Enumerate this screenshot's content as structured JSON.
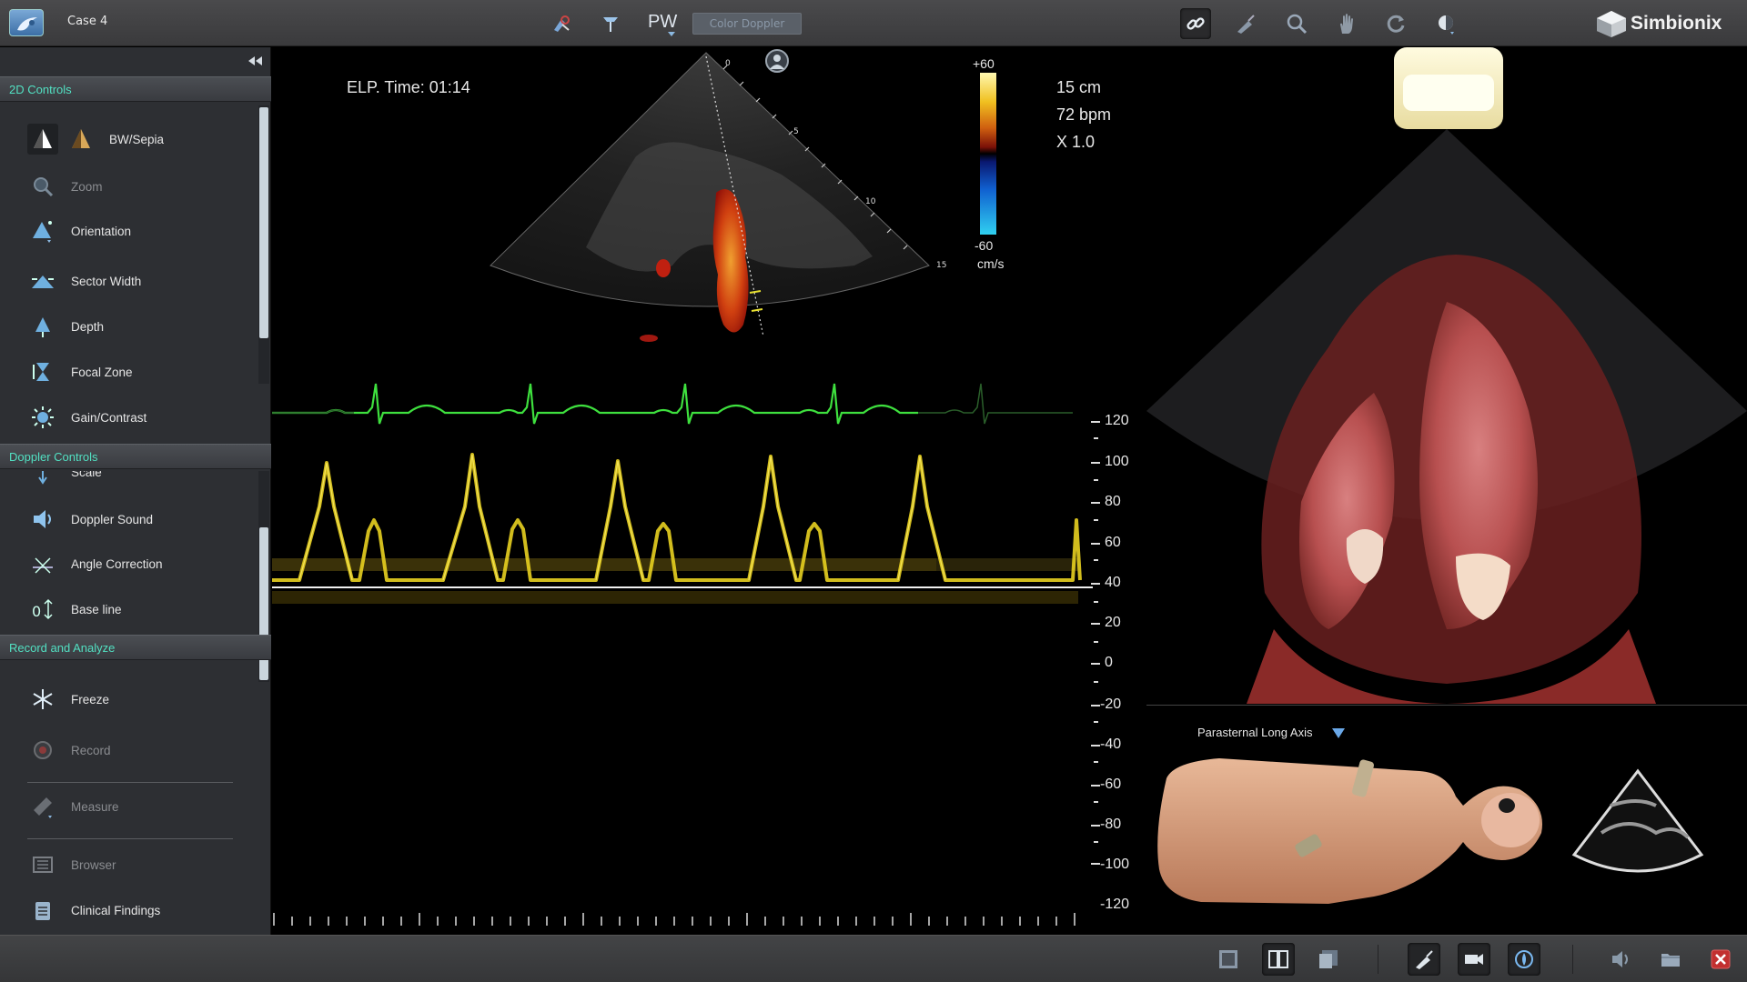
{
  "topbar": {
    "case_title": "Case 4",
    "mode_label": "PW",
    "color_doppler_label": "Color Doppler",
    "brand_name": "Simbionix",
    "tools_left": [
      "probe-settings-icon",
      "cursor-probe-icon"
    ],
    "tools_right": [
      "link-icon",
      "probe-icon",
      "zoom-icon",
      "hand-icon",
      "rotate-icon",
      "contrast-icon"
    ]
  },
  "left_panel": {
    "sections": {
      "controls_2d": "2D Controls",
      "doppler_controls": "Doppler Controls",
      "record_analyze": "Record and Analyze"
    },
    "controls_2d_items": [
      {
        "label": "BW/Sepia",
        "icon": "bw-sepia-icon",
        "enabled": true
      },
      {
        "label": "Zoom",
        "icon": "zoom-icon",
        "enabled": false
      },
      {
        "label": "Orientation",
        "icon": "orientation-icon",
        "enabled": true
      },
      {
        "label": "Sector Width",
        "icon": "sector-width-icon",
        "enabled": true
      },
      {
        "label": "Depth",
        "icon": "depth-icon",
        "enabled": true
      },
      {
        "label": "Focal Zone",
        "icon": "focal-zone-icon",
        "enabled": true
      },
      {
        "label": "Gain/Contrast",
        "icon": "gain-contrast-icon",
        "enabled": true
      }
    ],
    "doppler_items": [
      {
        "label": "Scale",
        "icon": "scale-icon",
        "enabled": true
      },
      {
        "label": "Doppler Sound",
        "icon": "speaker-icon",
        "enabled": true
      },
      {
        "label": "Angle Correction",
        "icon": "angle-correction-icon",
        "enabled": true
      },
      {
        "label": "Base line",
        "icon": "baseline-icon",
        "enabled": true
      }
    ],
    "record_items": [
      {
        "label": "Freeze",
        "icon": "snowflake-icon",
        "enabled": true
      },
      {
        "label": "Record",
        "icon": "record-icon",
        "enabled": false
      },
      {
        "label": "Measure",
        "icon": "ruler-icon",
        "enabled": false
      },
      {
        "label": "Browser",
        "icon": "browser-icon",
        "enabled": false
      },
      {
        "label": "Clinical Findings",
        "icon": "clipboard-icon",
        "enabled": true
      }
    ]
  },
  "ultrasound": {
    "elapsed_time": "ELP. Time: 01:14",
    "depth": "15 cm",
    "heart_rate": "72 bpm",
    "zoom": "X 1.0",
    "color_scale_max": "+60",
    "color_scale_min": "-60",
    "color_scale_unit": "cm/s",
    "depth_ticks": [
      "0",
      "5",
      "10",
      "15"
    ],
    "velocity_axis_labels": [
      "120",
      "100",
      "80",
      "60",
      "40",
      "20",
      "0",
      "-20",
      "-40",
      "-60",
      "-80",
      "-100",
      "-120"
    ],
    "colors": {
      "ecg_trace": "#33dd33",
      "doppler_spectrum": "#e8d020",
      "baseline": "#ffffff"
    }
  },
  "anatomy": {
    "view_name": "Parasternal Long Axis"
  },
  "bottombar": {
    "tools": [
      "single-view-icon",
      "dual-view-icon",
      "overlay-view-icon",
      "probe-view-icon",
      "camera-view-icon",
      "anatomy-view-icon",
      "sound-icon",
      "folder-icon",
      "close-icon"
    ]
  }
}
